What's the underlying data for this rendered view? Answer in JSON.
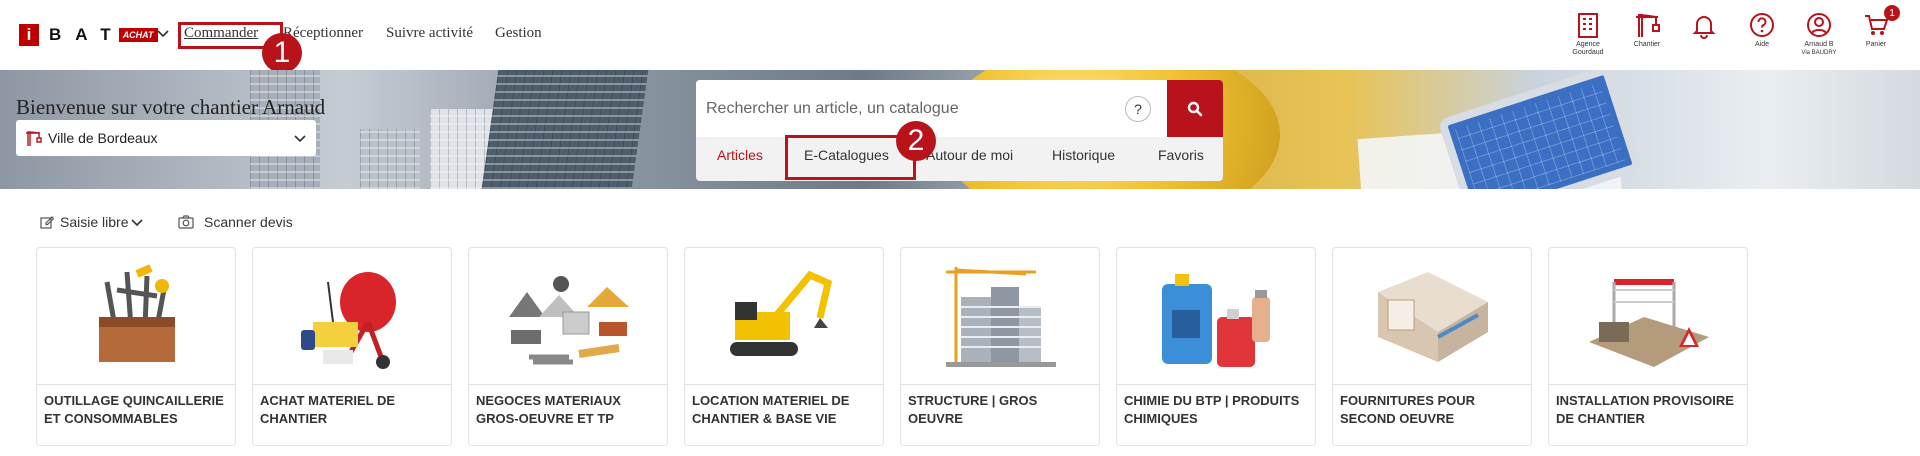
{
  "header": {
    "logo_letter": "i",
    "logo_text": "BAT",
    "logo_badge": "ACHAT",
    "nav": [
      "Commander",
      "Réceptionner",
      "Suivre activité",
      "Gestion"
    ],
    "icons": [
      {
        "icon": "building-icon",
        "label_1": "Agence",
        "label_2": "Gourdaud"
      },
      {
        "icon": "crane-icon",
        "label_1": "Chantier",
        "label_2": ""
      },
      {
        "icon": "bell-icon",
        "label_1": "",
        "label_2": ""
      },
      {
        "icon": "help-icon",
        "label_1": "Aide",
        "label_2": ""
      },
      {
        "icon": "user-icon",
        "label_1": "Arnaud B",
        "label_2": "Via BAUDRY"
      },
      {
        "icon": "cart-icon",
        "label_1": "Panier",
        "label_2": "",
        "badge": "1"
      }
    ]
  },
  "steps": {
    "step1": "1",
    "step2": "2"
  },
  "banner": {
    "welcome": "Bienvenue sur votre chantier Arnaud",
    "site": "Ville de Bordeaux"
  },
  "search": {
    "placeholder": "Rechercher un article, un catalogue",
    "help": "?",
    "tabs": [
      "Articles",
      "E-Catalogues",
      "Autour de moi",
      "Historique",
      "Favoris"
    ]
  },
  "tools": {
    "free_entry": "Saisie libre",
    "scan": "Scanner devis"
  },
  "categories": [
    "OUTILLAGE QUINCAILLERIE ET CONSOMMABLES",
    "ACHAT MATERIEL DE CHANTIER",
    "NEGOCES MATERIAUX GROS-OEUVRE ET TP",
    "LOCATION MATERIEL DE CHANTIER & BASE VIE",
    "STRUCTURE | GROS OEUVRE",
    "CHIMIE DU BTP | PRODUITS CHIMIQUES",
    "FOURNITURES POUR SECOND OEUVRE",
    "INSTALLATION PROVISOIRE DE CHANTIER"
  ],
  "colors": {
    "brand": "#b8121b"
  }
}
